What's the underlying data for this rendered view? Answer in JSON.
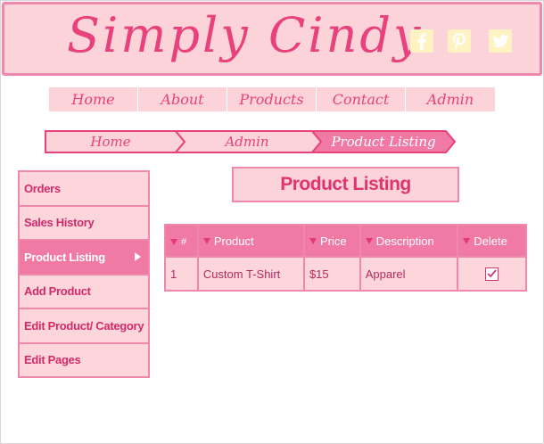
{
  "header": {
    "logo": "Simply Cindy",
    "social": [
      {
        "icon": "facebook-icon"
      },
      {
        "icon": "pinterest-icon"
      },
      {
        "icon": "twitter-icon"
      }
    ]
  },
  "nav": [
    "Home",
    "About",
    "Products",
    "Contact",
    "Admin"
  ],
  "breadcrumb": [
    "Home",
    "Admin",
    "Product Listing"
  ],
  "sidebar": {
    "items": [
      "Orders",
      "Sales History",
      "Product Listing",
      "Add Product",
      "Edit Product/ Category",
      "Edit Pages"
    ],
    "active_index": 2
  },
  "main": {
    "title": "Product Listing",
    "table": {
      "columns": [
        "#",
        "Product",
        "Price",
        "Description",
        "Delete"
      ],
      "rows": [
        {
          "num": "1",
          "product": "Custom T-Shirt",
          "price": "$15",
          "description": "Apparel",
          "delete_checked": true
        }
      ]
    }
  },
  "colors": {
    "pink_light": "#fcd3d8",
    "pink_border": "#ef88ac",
    "pink_active": "#f07aa4",
    "brand_text": "#e8417c",
    "social_icon": "#fff3c4"
  }
}
